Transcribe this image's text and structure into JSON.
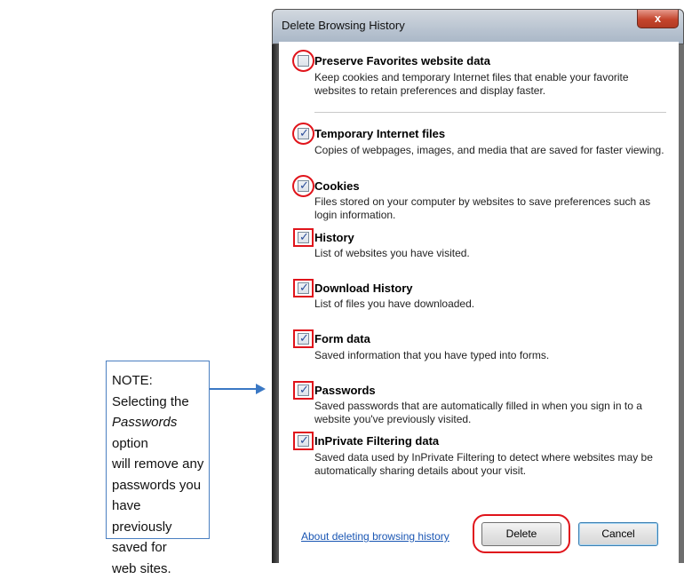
{
  "note": {
    "line1": "NOTE:  Selecting the",
    "italic_word": "Passwords",
    "line2_rest": " option",
    "line3": "will remove any",
    "line4": "passwords you have",
    "line5": "previously saved for",
    "line6": "web sites."
  },
  "dialog": {
    "title": "Delete Browsing History",
    "close_label": "x",
    "options": [
      {
        "title": "Preserve Favorites website data",
        "desc": "Keep cookies and temporary Internet files that enable your favorite websites to retain preferences and display faster.",
        "checked": false
      },
      {
        "title": "Temporary Internet files",
        "desc": "Copies of webpages, images, and media that are saved for faster viewing.",
        "checked": true
      },
      {
        "title": "Cookies",
        "desc": "Files stored on your computer by websites to save preferences such as login information.",
        "checked": true
      },
      {
        "title": "History",
        "desc": "List of websites you have visited.",
        "checked": true
      },
      {
        "title": "Download History",
        "desc": "List of files you have downloaded.",
        "checked": true
      },
      {
        "title": "Form data",
        "desc": "Saved information that you have typed into forms.",
        "checked": true
      },
      {
        "title": "Passwords",
        "desc": "Saved passwords that are automatically filled in when you sign in to a website you've previously visited.",
        "checked": true
      },
      {
        "title": "InPrivate Filtering data",
        "desc": "Saved data used by InPrivate Filtering to detect where websites may be automatically sharing details about your visit.",
        "checked": true
      }
    ],
    "about_link": "About deleting browsing history",
    "delete_label": "Delete",
    "cancel_label": "Cancel"
  },
  "colors": {
    "highlight": "#e0141b",
    "arrow": "#3a78c4",
    "link": "#1a56b3"
  }
}
